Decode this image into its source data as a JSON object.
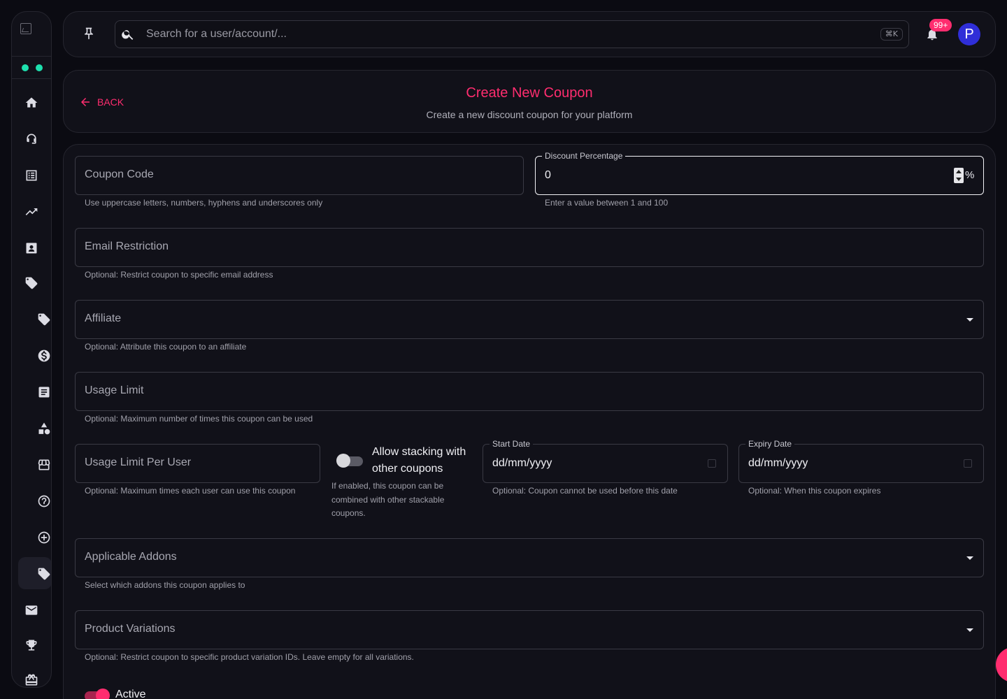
{
  "sidebar": {
    "icons": [
      "home-icon",
      "support-agent-icon",
      "list-icon",
      "trending-up-icon",
      "contact-icon",
      "tag-icon",
      "tag-icon",
      "dollar-icon",
      "article-icon",
      "shapes-icon",
      "storefront-icon",
      "help-icon",
      "add-circle-icon",
      "tag-icon",
      "mail-icon",
      "trophy-icon",
      "gift-card-icon"
    ],
    "active_index": 13,
    "status_dot_color": "#1ee0ae"
  },
  "topbar": {
    "search_placeholder": "Search for a user/account/...",
    "shortcut": "⌘K",
    "notification_count": "99+",
    "avatar_initial": "P"
  },
  "header": {
    "back_label": "BACK",
    "title": "Create New Coupon",
    "subtitle": "Create a new discount coupon for your platform"
  },
  "form": {
    "coupon_code": {
      "label": "Coupon Code",
      "helper": "Use uppercase letters, numbers, hyphens and underscores only"
    },
    "discount_percentage": {
      "label": "Discount Percentage",
      "value": "0",
      "unit": "%",
      "helper": "Enter a value between 1 and 100"
    },
    "email_restriction": {
      "label": "Email Restriction",
      "helper": "Optional: Restrict coupon to specific email address"
    },
    "affiliate": {
      "label": "Affiliate",
      "helper": "Optional: Attribute this coupon to an affiliate"
    },
    "usage_limit": {
      "label": "Usage Limit",
      "helper": "Optional: Maximum number of times this coupon can be used"
    },
    "usage_limit_per_user": {
      "label": "Usage Limit Per User",
      "helper": "Optional: Maximum times each user can use this coupon"
    },
    "stacking": {
      "label": "Allow stacking with other coupons",
      "helper": "If enabled, this coupon can be combined with other stackable coupons.",
      "enabled": false
    },
    "start_date": {
      "label": "Start Date",
      "value": "dd/mm/yyyy",
      "helper": "Optional: Coupon cannot be used before this date"
    },
    "expiry_date": {
      "label": "Expiry Date",
      "value": "dd/mm/yyyy",
      "helper": "Optional: When this coupon expires"
    },
    "applicable_addons": {
      "label": "Applicable Addons",
      "helper": "Select which addons this coupon applies to"
    },
    "product_variations": {
      "label": "Product Variations",
      "helper": "Optional: Restrict coupon to specific product variation IDs. Leave empty for all variations."
    },
    "active": {
      "label": "Active",
      "enabled": true
    }
  },
  "colors": {
    "accent": "#ff2d6f",
    "background": "#0b0b12",
    "card": "#111119",
    "avatar": "#2f2ed8"
  }
}
